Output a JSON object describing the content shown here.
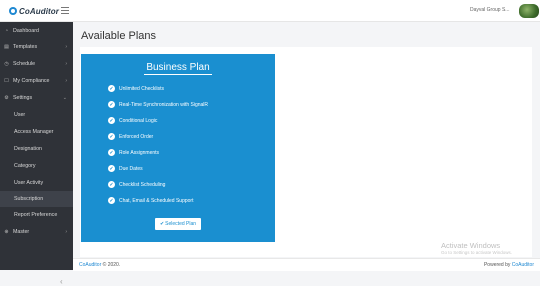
{
  "brand": {
    "name": "CoAuditor"
  },
  "header": {
    "user_name": "Dayval Group S..."
  },
  "sidebar": {
    "items": [
      {
        "label": "Dashboard",
        "icon": "dashboard-icon",
        "glyph": "◔"
      },
      {
        "label": "Templates",
        "icon": "templates-icon",
        "glyph": "▤",
        "chevron": "›"
      },
      {
        "label": "Schedule",
        "icon": "schedule-icon",
        "glyph": "◷",
        "chevron": "›"
      },
      {
        "label": "My Compliance",
        "icon": "compliance-icon",
        "glyph": "☐",
        "chevron": "›"
      },
      {
        "label": "Settings",
        "icon": "settings-icon",
        "glyph": "⚙",
        "chevron": "⌄"
      }
    ],
    "settings_children": [
      {
        "label": "User"
      },
      {
        "label": "Access Manager"
      },
      {
        "label": "Designation"
      },
      {
        "label": "Category"
      },
      {
        "label": "User Activity"
      },
      {
        "label": "Subscription"
      },
      {
        "label": "Report Preference"
      }
    ],
    "master": {
      "label": "Master",
      "glyph": "⊕",
      "chevron": "›"
    },
    "collapse_glyph": "‹"
  },
  "main": {
    "page_title": "Available Plans",
    "plan": {
      "title": "Business Plan",
      "features": [
        "Unlimited Checklists",
        "Real-Time Synchronization with SignalR",
        "Conditional Logic",
        "Enforced Order",
        "Role Assignments",
        "Due Dates",
        "Checklist Scheduling",
        "Chat, Email & Scheduled Support"
      ],
      "button_label": "Selected Plan"
    }
  },
  "watermark": {
    "line1": "Activate Windows",
    "line2": "Go to Settings to activate Windows."
  },
  "footer": {
    "left_brand": "CoAuditor",
    "left_text": " © 2020.",
    "right_text": "Powered by ",
    "right_brand": "CoAuditor"
  },
  "colors": {
    "accent": "#1a8fd0",
    "sidebar_bg": "#2f3238"
  }
}
